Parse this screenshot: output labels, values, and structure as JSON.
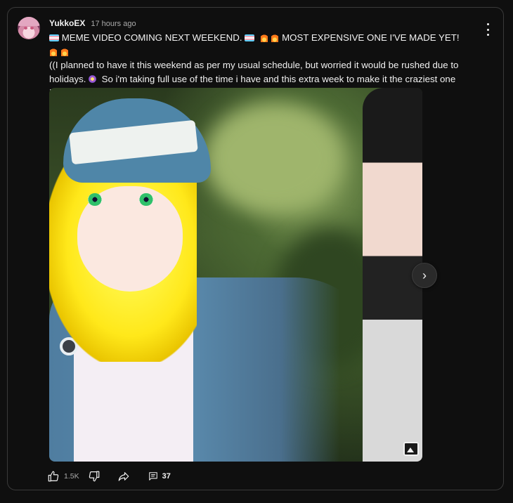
{
  "post": {
    "author": "YukkoEX",
    "time": "17 hours ago",
    "line1_a": "MEME VIDEO COMING NEXT WEEKEND.",
    "line1_b": "MOST EXPENSIVE ONE I'VE MADE YET!",
    "line2_a": "((I planned to have it this weekend as per my usual schedule, but worried it would be rushed due to holidays.",
    "line2_b": "So i'm taking full use of the time i have and this extra week to make it the craziest one I've ever made!))"
  },
  "media": {
    "next_glyph": "›"
  },
  "actions": {
    "like_count": "1.5K",
    "comment_count": "37"
  },
  "icons": {
    "avatar": "avatar-image",
    "menu": "more-vert-icon",
    "next": "chevron-right-icon",
    "gallery": "image-gallery-icon",
    "like": "thumbs-up-icon",
    "dislike": "thumbs-down-icon",
    "share": "share-icon",
    "comment": "comment-icon",
    "emoji_flag": "transgender-flag-emoji",
    "emoji_fire": "fire-emoji",
    "emoji_orb": "orb-emoji"
  }
}
